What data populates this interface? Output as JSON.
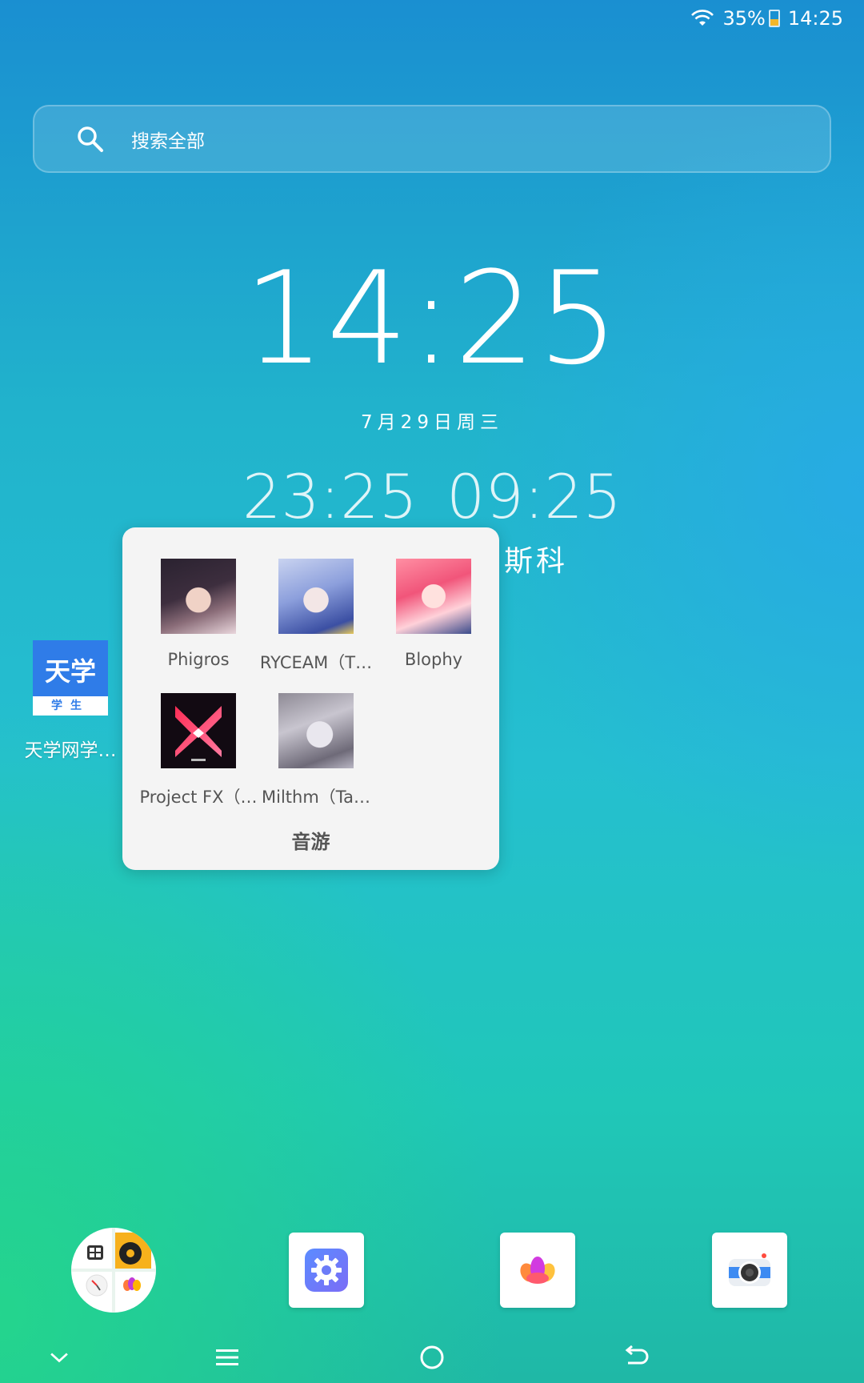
{
  "status_bar": {
    "battery": "35%",
    "time": "14:25",
    "icons": [
      "wifi-icon",
      "battery-icon"
    ],
    "battery_color": "#f2b72a"
  },
  "search": {
    "placeholder": "搜索全部",
    "icon": "search-icon"
  },
  "clock": {
    "time": "14:25",
    "date": "7月29日周三",
    "world_times": [
      "23:25",
      "09:25"
    ],
    "city_label": "斯科"
  },
  "desktop_apps": [
    {
      "label": "天学网学…",
      "icon_text": "天学",
      "icon_subtext": "学生",
      "color": "#2f7ce8"
    }
  ],
  "folder": {
    "title": "音游",
    "apps": [
      {
        "label": "Phigros"
      },
      {
        "label": "RYCEAM（T…"
      },
      {
        "label": "Blophy"
      },
      {
        "label": "Project FX（…"
      },
      {
        "label": "Milthm（Ta…"
      }
    ]
  },
  "dock": {
    "items": [
      "app-folder",
      "settings-icon",
      "gallery-icon",
      "camera-icon"
    ]
  },
  "nav_bar": {
    "items": [
      "chevron-down-icon",
      "menu-icon",
      "home-icon",
      "back-icon"
    ]
  }
}
